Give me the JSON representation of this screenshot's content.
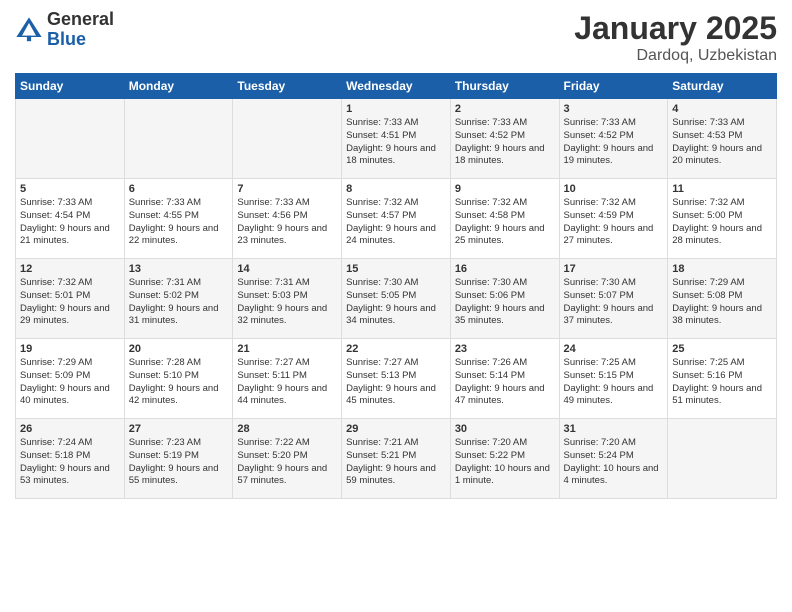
{
  "header": {
    "logo_general": "General",
    "logo_blue": "Blue",
    "month": "January 2025",
    "location": "Dardoq, Uzbekistan"
  },
  "days_of_week": [
    "Sunday",
    "Monday",
    "Tuesday",
    "Wednesday",
    "Thursday",
    "Friday",
    "Saturday"
  ],
  "weeks": [
    [
      {
        "day": "",
        "text": ""
      },
      {
        "day": "",
        "text": ""
      },
      {
        "day": "",
        "text": ""
      },
      {
        "day": "1",
        "text": "Sunrise: 7:33 AM\nSunset: 4:51 PM\nDaylight: 9 hours\nand 18 minutes."
      },
      {
        "day": "2",
        "text": "Sunrise: 7:33 AM\nSunset: 4:52 PM\nDaylight: 9 hours\nand 18 minutes."
      },
      {
        "day": "3",
        "text": "Sunrise: 7:33 AM\nSunset: 4:52 PM\nDaylight: 9 hours\nand 19 minutes."
      },
      {
        "day": "4",
        "text": "Sunrise: 7:33 AM\nSunset: 4:53 PM\nDaylight: 9 hours\nand 20 minutes."
      }
    ],
    [
      {
        "day": "5",
        "text": "Sunrise: 7:33 AM\nSunset: 4:54 PM\nDaylight: 9 hours\nand 21 minutes."
      },
      {
        "day": "6",
        "text": "Sunrise: 7:33 AM\nSunset: 4:55 PM\nDaylight: 9 hours\nand 22 minutes."
      },
      {
        "day": "7",
        "text": "Sunrise: 7:33 AM\nSunset: 4:56 PM\nDaylight: 9 hours\nand 23 minutes."
      },
      {
        "day": "8",
        "text": "Sunrise: 7:32 AM\nSunset: 4:57 PM\nDaylight: 9 hours\nand 24 minutes."
      },
      {
        "day": "9",
        "text": "Sunrise: 7:32 AM\nSunset: 4:58 PM\nDaylight: 9 hours\nand 25 minutes."
      },
      {
        "day": "10",
        "text": "Sunrise: 7:32 AM\nSunset: 4:59 PM\nDaylight: 9 hours\nand 27 minutes."
      },
      {
        "day": "11",
        "text": "Sunrise: 7:32 AM\nSunset: 5:00 PM\nDaylight: 9 hours\nand 28 minutes."
      }
    ],
    [
      {
        "day": "12",
        "text": "Sunrise: 7:32 AM\nSunset: 5:01 PM\nDaylight: 9 hours\nand 29 minutes."
      },
      {
        "day": "13",
        "text": "Sunrise: 7:31 AM\nSunset: 5:02 PM\nDaylight: 9 hours\nand 31 minutes."
      },
      {
        "day": "14",
        "text": "Sunrise: 7:31 AM\nSunset: 5:03 PM\nDaylight: 9 hours\nand 32 minutes."
      },
      {
        "day": "15",
        "text": "Sunrise: 7:30 AM\nSunset: 5:05 PM\nDaylight: 9 hours\nand 34 minutes."
      },
      {
        "day": "16",
        "text": "Sunrise: 7:30 AM\nSunset: 5:06 PM\nDaylight: 9 hours\nand 35 minutes."
      },
      {
        "day": "17",
        "text": "Sunrise: 7:30 AM\nSunset: 5:07 PM\nDaylight: 9 hours\nand 37 minutes."
      },
      {
        "day": "18",
        "text": "Sunrise: 7:29 AM\nSunset: 5:08 PM\nDaylight: 9 hours\nand 38 minutes."
      }
    ],
    [
      {
        "day": "19",
        "text": "Sunrise: 7:29 AM\nSunset: 5:09 PM\nDaylight: 9 hours\nand 40 minutes."
      },
      {
        "day": "20",
        "text": "Sunrise: 7:28 AM\nSunset: 5:10 PM\nDaylight: 9 hours\nand 42 minutes."
      },
      {
        "day": "21",
        "text": "Sunrise: 7:27 AM\nSunset: 5:11 PM\nDaylight: 9 hours\nand 44 minutes."
      },
      {
        "day": "22",
        "text": "Sunrise: 7:27 AM\nSunset: 5:13 PM\nDaylight: 9 hours\nand 45 minutes."
      },
      {
        "day": "23",
        "text": "Sunrise: 7:26 AM\nSunset: 5:14 PM\nDaylight: 9 hours\nand 47 minutes."
      },
      {
        "day": "24",
        "text": "Sunrise: 7:25 AM\nSunset: 5:15 PM\nDaylight: 9 hours\nand 49 minutes."
      },
      {
        "day": "25",
        "text": "Sunrise: 7:25 AM\nSunset: 5:16 PM\nDaylight: 9 hours\nand 51 minutes."
      }
    ],
    [
      {
        "day": "26",
        "text": "Sunrise: 7:24 AM\nSunset: 5:18 PM\nDaylight: 9 hours\nand 53 minutes."
      },
      {
        "day": "27",
        "text": "Sunrise: 7:23 AM\nSunset: 5:19 PM\nDaylight: 9 hours\nand 55 minutes."
      },
      {
        "day": "28",
        "text": "Sunrise: 7:22 AM\nSunset: 5:20 PM\nDaylight: 9 hours\nand 57 minutes."
      },
      {
        "day": "29",
        "text": "Sunrise: 7:21 AM\nSunset: 5:21 PM\nDaylight: 9 hours\nand 59 minutes."
      },
      {
        "day": "30",
        "text": "Sunrise: 7:20 AM\nSunset: 5:22 PM\nDaylight: 10 hours\nand 1 minute."
      },
      {
        "day": "31",
        "text": "Sunrise: 7:20 AM\nSunset: 5:24 PM\nDaylight: 10 hours\nand 4 minutes."
      },
      {
        "day": "",
        "text": ""
      }
    ]
  ]
}
